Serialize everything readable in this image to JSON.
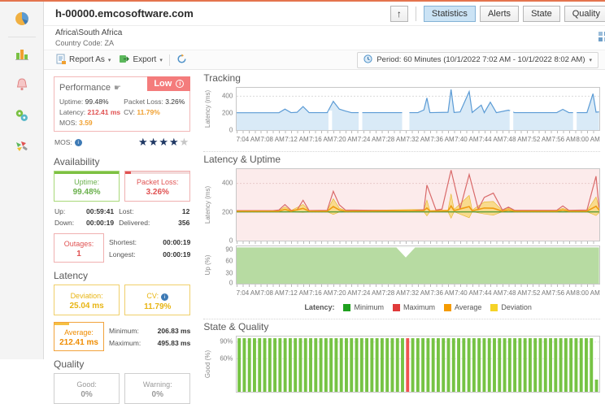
{
  "header": {
    "title": "h-00000.emcosoftware.com",
    "group": "Africa\\South Africa",
    "country": "Country Code: ZA",
    "view_buttons": [
      {
        "label": "Statistics",
        "active": true
      },
      {
        "label": "Alerts",
        "active": false
      },
      {
        "label": "State",
        "active": false
      },
      {
        "label": "Quality",
        "active": false
      }
    ]
  },
  "toolbar": {
    "report_as_label": "Report As",
    "export_label": "Export",
    "period_label": "Period: 60 Minutes (10/1/2022 7:02 AM - 10/1/2022 8:02 AM)"
  },
  "sidebar": {
    "icons": [
      "pie-chart-icon",
      "bar-chart-icon",
      "alerts-bell-icon",
      "status-circles-icon",
      "tools-palette-icon"
    ]
  },
  "performance": {
    "title": "Performance",
    "badge": "Low",
    "uptime_label": "Uptime:",
    "uptime_value": "99.48%",
    "packet_loss_label": "Packet Loss:",
    "packet_loss_value": "3.26%",
    "latency_label": "Latency:",
    "latency_value": "212.41 ms",
    "cv_label": "CV:",
    "cv_value": "11.79%",
    "mos_label": "MOS:",
    "mos_value": "3.59",
    "mos_row_label": "MOS:",
    "stars_filled": 4,
    "stars_total": 5
  },
  "availability": {
    "header": "Availability",
    "uptime_box": {
      "label": "Uptime:",
      "value": "99.48%"
    },
    "packet_loss_box": {
      "label": "Packet Loss:",
      "value": "3.26%"
    },
    "up_label": "Up:",
    "up_value": "00:59:41",
    "lost_label": "Lost:",
    "lost_value": "12",
    "down_label": "Down:",
    "down_value": "00:00:19",
    "delivered_label": "Delivered:",
    "delivered_value": "356",
    "outages_box": {
      "label": "Outages:",
      "value": "1"
    },
    "shortest_label": "Shortest:",
    "shortest_value": "00:00:19",
    "longest_label": "Longest:",
    "longest_value": "00:00:19"
  },
  "latency_section": {
    "header": "Latency",
    "deviation_box": {
      "label": "Deviation:",
      "value": "25.04 ms"
    },
    "cv_box": {
      "label": "CV:",
      "value": "11.79%"
    },
    "average_box": {
      "label": "Average:",
      "value": "212.41 ms"
    },
    "minimum_label": "Minimum:",
    "minimum_value": "206.83 ms",
    "maximum_label": "Maximum:",
    "maximum_value": "495.83 ms"
  },
  "quality_section": {
    "header": "Quality",
    "good_box": {
      "label": "Good:",
      "value": "0%"
    },
    "warning_box": {
      "label": "Warning:",
      "value": "0%"
    }
  },
  "charts": {
    "tracking_title": "Tracking",
    "latency_uptime_title": "Latency & Uptime",
    "state_quality_title": "State & Quality",
    "tracking_ylabel": "Latency (ms)",
    "lu_ylabel": "Latency (ms)",
    "up_ylabel": "Up (%)",
    "state_ylabel": "Good (%)",
    "tracking_yticks": [
      "400",
      "200",
      "0"
    ],
    "lu_yticks": [
      "400",
      "200",
      "0"
    ],
    "up_yticks": [
      "90",
      "60",
      "30",
      "0"
    ],
    "state_yticks": [
      "90%",
      "60%"
    ],
    "legend_title": "Latency:",
    "legend": [
      {
        "label": "Minimum",
        "color": "#1fa01f"
      },
      {
        "label": "Maximum",
        "color": "#e03a3a"
      },
      {
        "label": "Average",
        "color": "#f59b00"
      },
      {
        "label": "Deviation",
        "color": "#f5d327"
      }
    ]
  },
  "chart_data": {
    "xticks": {
      "labels": [
        "7:04 AM",
        "7:08 AM",
        "7:12 AM",
        "7:16 AM",
        "7:20 AM",
        "7:24 AM",
        "7:28 AM",
        "7:32 AM",
        "7:36 AM",
        "7:40 AM",
        "7:44 AM",
        "7:48 AM",
        "7:52 AM",
        "7:56 AM",
        "8:00 AM"
      ],
      "minutes_after_start": [
        2,
        6,
        10,
        14,
        18,
        22,
        26,
        30,
        34,
        38,
        42,
        46,
        50,
        54,
        58
      ],
      "range_minutes": [
        0,
        60
      ],
      "start_time": "7:02 AM",
      "end_time": "8:02 AM"
    },
    "tracking": {
      "type": "area",
      "ylim": [
        0,
        500
      ],
      "line_color": "#5b9bd5",
      "fill_color": "#d9eaf7",
      "points": [
        [
          0,
          205
        ],
        [
          7,
          205
        ],
        [
          8,
          248
        ],
        [
          9,
          206
        ],
        [
          10,
          210
        ],
        [
          11,
          278
        ],
        [
          12,
          206
        ],
        [
          15,
          206
        ],
        [
          16,
          340
        ],
        [
          17,
          248
        ],
        [
          18,
          225
        ],
        [
          19,
          206
        ],
        [
          30,
          206
        ],
        [
          31,
          238
        ],
        [
          31.5,
          380
        ],
        [
          32,
          206
        ],
        [
          35,
          210
        ],
        [
          35.5,
          480
        ],
        [
          36,
          208
        ],
        [
          37,
          214
        ],
        [
          38.5,
          455
        ],
        [
          39,
          208
        ],
        [
          40.5,
          295
        ],
        [
          41,
          206
        ],
        [
          42,
          330
        ],
        [
          43,
          206
        ],
        [
          45,
          235
        ],
        [
          46,
          206
        ],
        [
          53,
          206
        ],
        [
          54,
          245
        ],
        [
          55,
          206
        ],
        [
          58,
          206
        ],
        [
          59,
          430
        ],
        [
          59.5,
          212
        ],
        [
          60,
          215
        ]
      ],
      "gaps": [
        [
          15.2,
          15.8
        ],
        [
          20.2,
          20.8
        ],
        [
          27.4,
          28.6
        ],
        [
          45.2,
          45.8
        ],
        [
          55.7,
          56.3
        ]
      ]
    },
    "latency_uptime": {
      "type": "line",
      "ylim": [
        0,
        500
      ],
      "bg": "#fcebeb",
      "maximum": {
        "color": "#d96a6a",
        "points": [
          [
            0,
            210
          ],
          [
            6,
            210
          ],
          [
            7,
            214
          ],
          [
            8,
            252
          ],
          [
            9,
            212
          ],
          [
            10,
            214
          ],
          [
            11,
            282
          ],
          [
            12,
            210
          ],
          [
            15,
            212
          ],
          [
            16,
            345
          ],
          [
            17,
            250
          ],
          [
            18,
            214
          ],
          [
            27,
            210
          ],
          [
            29,
            210
          ],
          [
            31,
            216
          ],
          [
            31.5,
            388
          ],
          [
            33,
            214
          ],
          [
            34,
            220
          ],
          [
            35.5,
            492
          ],
          [
            37,
            224
          ],
          [
            38.5,
            462
          ],
          [
            40,
            220
          ],
          [
            41,
            302
          ],
          [
            42.5,
            332
          ],
          [
            44,
            214
          ],
          [
            45,
            234
          ],
          [
            46,
            212
          ],
          [
            53,
            212
          ],
          [
            54,
            242
          ],
          [
            55,
            212
          ],
          [
            58,
            214
          ],
          [
            59.5,
            450
          ],
          [
            60,
            230
          ]
        ]
      },
      "average": {
        "color": "#ef9a10",
        "points": [
          [
            0,
            206
          ],
          [
            7,
            206
          ],
          [
            8,
            218
          ],
          [
            9,
            206
          ],
          [
            11,
            225
          ],
          [
            12,
            206
          ],
          [
            15,
            206
          ],
          [
            16,
            238
          ],
          [
            17,
            214
          ],
          [
            18,
            206
          ],
          [
            31,
            210
          ],
          [
            31.5,
            228
          ],
          [
            32,
            206
          ],
          [
            35,
            208
          ],
          [
            35.5,
            242
          ],
          [
            36,
            210
          ],
          [
            38.5,
            238
          ],
          [
            39,
            208
          ],
          [
            41,
            228
          ],
          [
            42.5,
            226
          ],
          [
            44,
            206
          ],
          [
            45,
            214
          ],
          [
            46,
            206
          ],
          [
            53,
            206
          ],
          [
            54,
            214
          ],
          [
            55,
            206
          ],
          [
            58,
            206
          ],
          [
            59.5,
            240
          ],
          [
            60,
            214
          ]
        ]
      },
      "minimum": {
        "color": "#5f9e3e",
        "points": [
          [
            0,
            201
          ],
          [
            60,
            201
          ]
        ]
      },
      "deviation_halfwidth": {
        "color": "#f6d14f",
        "points": [
          [
            0,
            4
          ],
          [
            7,
            4
          ],
          [
            8,
            18
          ],
          [
            9,
            4
          ],
          [
            11,
            28
          ],
          [
            12,
            4
          ],
          [
            15,
            4
          ],
          [
            16,
            55
          ],
          [
            17,
            14
          ],
          [
            18,
            4
          ],
          [
            31,
            8
          ],
          [
            31.5,
            55
          ],
          [
            32,
            4
          ],
          [
            35,
            6
          ],
          [
            35.5,
            85
          ],
          [
            36,
            8
          ],
          [
            38.5,
            78
          ],
          [
            39,
            6
          ],
          [
            41,
            42
          ],
          [
            42.5,
            48
          ],
          [
            44,
            4
          ],
          [
            45,
            12
          ],
          [
            46,
            4
          ],
          [
            53,
            4
          ],
          [
            54,
            12
          ],
          [
            55,
            4
          ],
          [
            58,
            4
          ],
          [
            59.5,
            65
          ],
          [
            60,
            20
          ]
        ]
      }
    },
    "uptime": {
      "type": "area",
      "ylim": [
        0,
        100
      ],
      "value_percent": 100,
      "fill_color": "#b7dba2",
      "outage_marker_minute": 28
    },
    "state_quality": {
      "type": "bar",
      "total_bars": 71,
      "down_indices": [
        33
      ],
      "short_indices": [
        70
      ],
      "good_color": "#76c344",
      "down_color": "#ef5350",
      "short_height_percent": 22
    }
  }
}
